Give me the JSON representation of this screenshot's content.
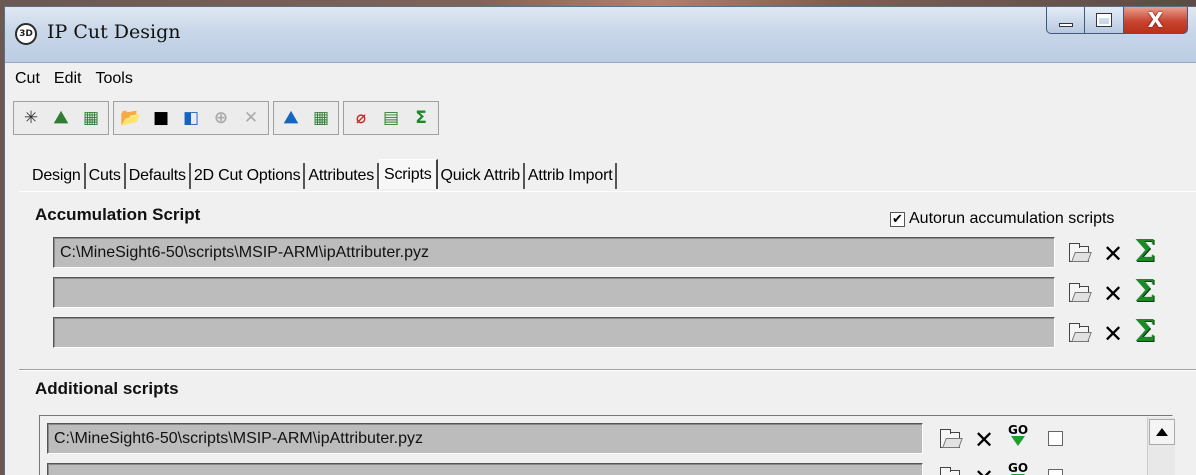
{
  "window": {
    "title": "IP Cut Design",
    "icon": "3d-app-icon"
  },
  "menu": [
    "Cut",
    "Edit",
    "Tools"
  ],
  "toolbar": {
    "groups": [
      [
        "new-cut-icon",
        "edit-cut-icon",
        "design-icon"
      ],
      [
        "open-icon",
        "save-icon",
        "save-as-icon",
        "copy-icon",
        "delete-icon"
      ],
      [
        "cut-view-icon",
        "grid-icon"
      ],
      [
        "erase-icon",
        "report-icon",
        "sigma-icon"
      ]
    ]
  },
  "tabs": [
    "Design",
    "Cuts",
    "Defaults",
    "2D Cut Options",
    "Attributes",
    "Scripts",
    "Quick Attrib",
    "Attrib Import"
  ],
  "active_tab": "Scripts",
  "accumulation": {
    "title": "Accumulation Script",
    "autorun_label": "Autorun accumulation scripts",
    "autorun_checked": true,
    "scripts": [
      "C:\\MineSight6-50\\scripts\\MSIP-ARM\\ipAttributer.pyz",
      "",
      ""
    ]
  },
  "additional": {
    "title": "Additional scripts",
    "scripts": [
      "C:\\MineSight6-50\\scripts\\MSIP-ARM\\ipAttributer.pyz",
      ""
    ],
    "go_label": "GO"
  },
  "glyphs": {
    "check": "✔",
    "delete": "✕",
    "sigma": "Σ",
    "close": "X"
  }
}
